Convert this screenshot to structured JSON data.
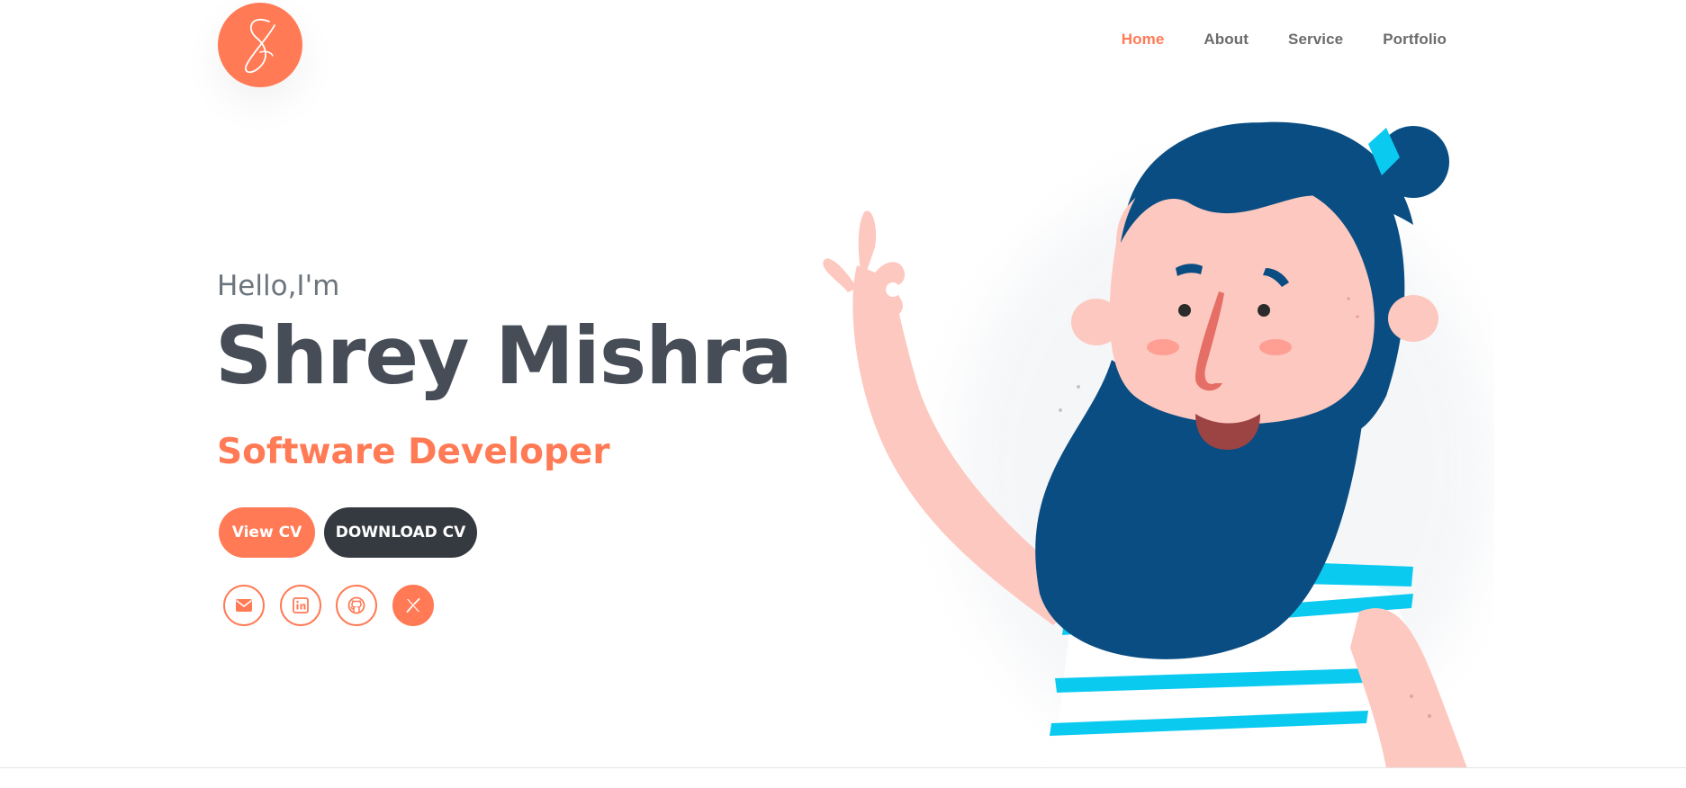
{
  "header": {
    "logo_alt": "S",
    "nav": [
      {
        "label": "Home",
        "active": true
      },
      {
        "label": "About",
        "active": false
      },
      {
        "label": "Service",
        "active": false
      },
      {
        "label": "Portfolio",
        "active": false
      }
    ]
  },
  "hero": {
    "greeting": "Hello,I'm",
    "name": "Shrey Mishra",
    "role": "Software Developer",
    "buttons": {
      "view_cv": "View CV",
      "download_cv": "DOWNLOAD CV"
    },
    "social": [
      {
        "icon": "envelope-icon"
      },
      {
        "icon": "linkedin-icon"
      },
      {
        "icon": "github-icon"
      },
      {
        "icon": "x-twitter-icon"
      }
    ]
  },
  "colors": {
    "accent": "#ff7a55",
    "dark": "#343a40",
    "heading": "#474d57",
    "muted": "#6c757d",
    "hair": "#0a4d82",
    "skin": "#fdc8bf",
    "stripe": "#0bcaf0"
  }
}
